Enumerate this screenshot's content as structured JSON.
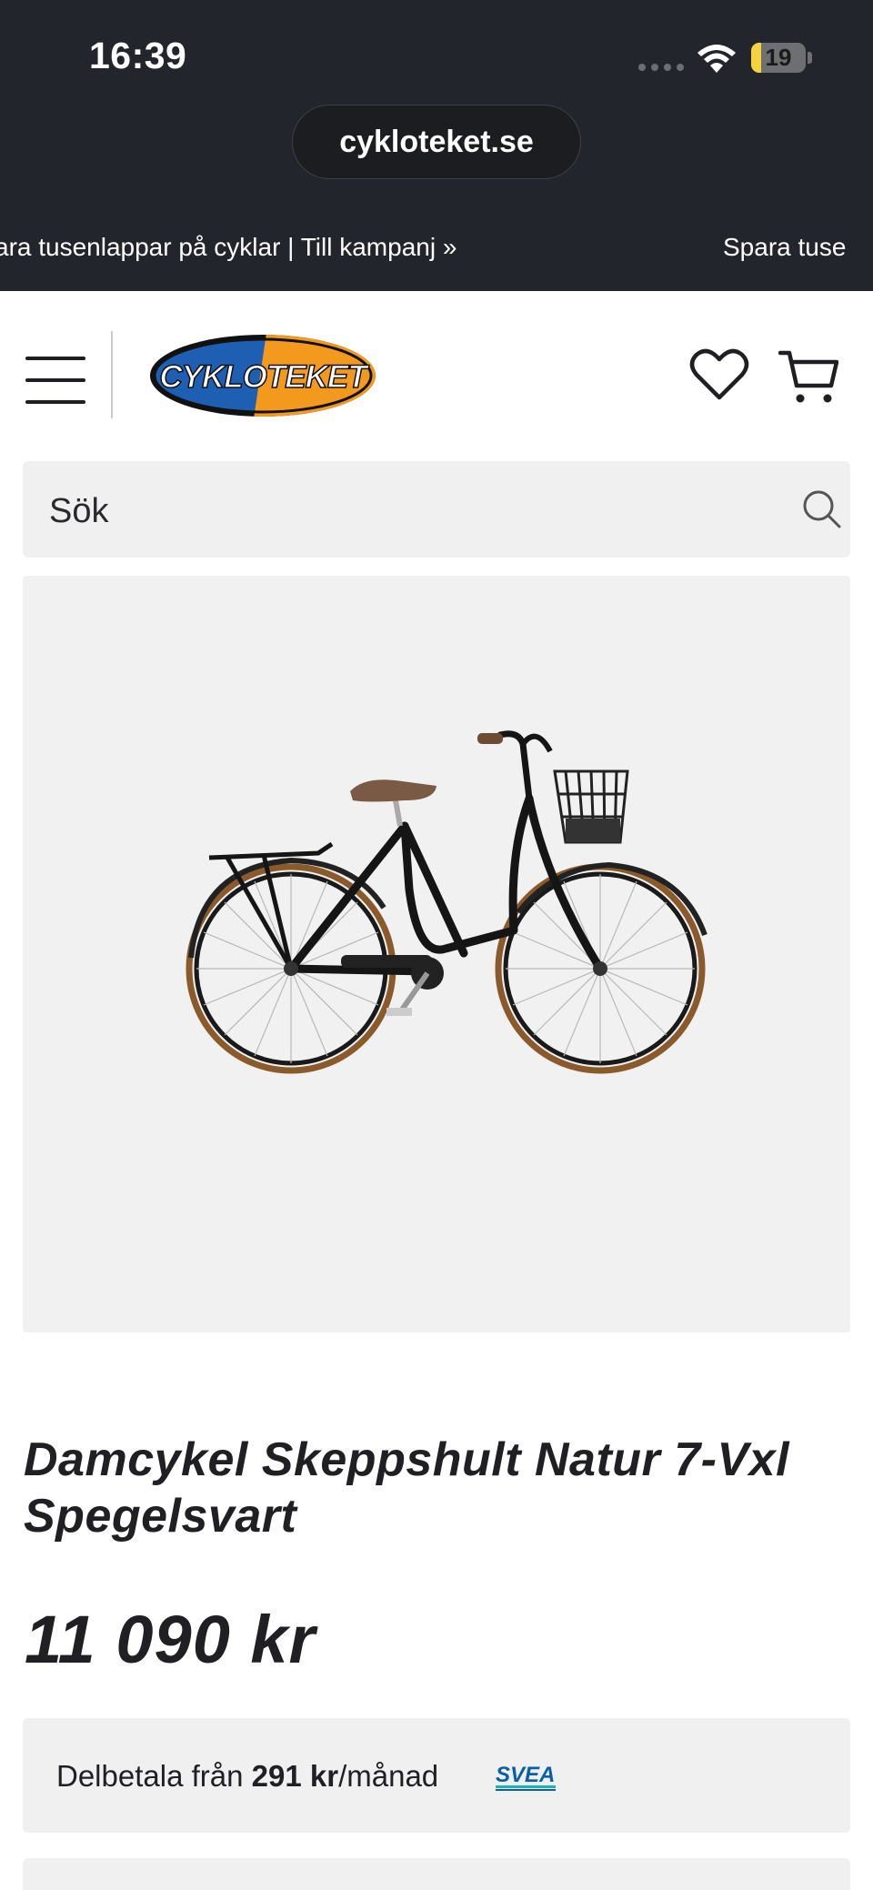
{
  "status_bar": {
    "time": "16:39",
    "battery_level": "19",
    "battery_fraction": 0.19
  },
  "browser": {
    "url": "cykloteket.se"
  },
  "promo_marquee": {
    "text_1": "ara tusenlappar på cyklar | Till kampanj »",
    "text_2": "Spara tuse"
  },
  "header": {
    "logo_text": "CYKLOTEKET",
    "icons": [
      "menu-icon",
      "heart-icon",
      "cart-icon"
    ]
  },
  "search": {
    "placeholder": "Sök"
  },
  "product": {
    "title": "Damcykel Skeppshult Natur 7-Vxl Spegelsvart",
    "price": "11 090 kr",
    "finance": {
      "prefix": "Delbetala från ",
      "amount": "291 kr",
      "suffix": "/månad",
      "provider": "SVEA"
    }
  },
  "colors": {
    "topbar": "#22252b",
    "logo_blue": "#1e5fb3",
    "logo_orange": "#f39a1e",
    "svea_blue": "#0a5fa8",
    "svea_teal": "#19b3b8",
    "panel_gray": "#f0f0f1"
  }
}
